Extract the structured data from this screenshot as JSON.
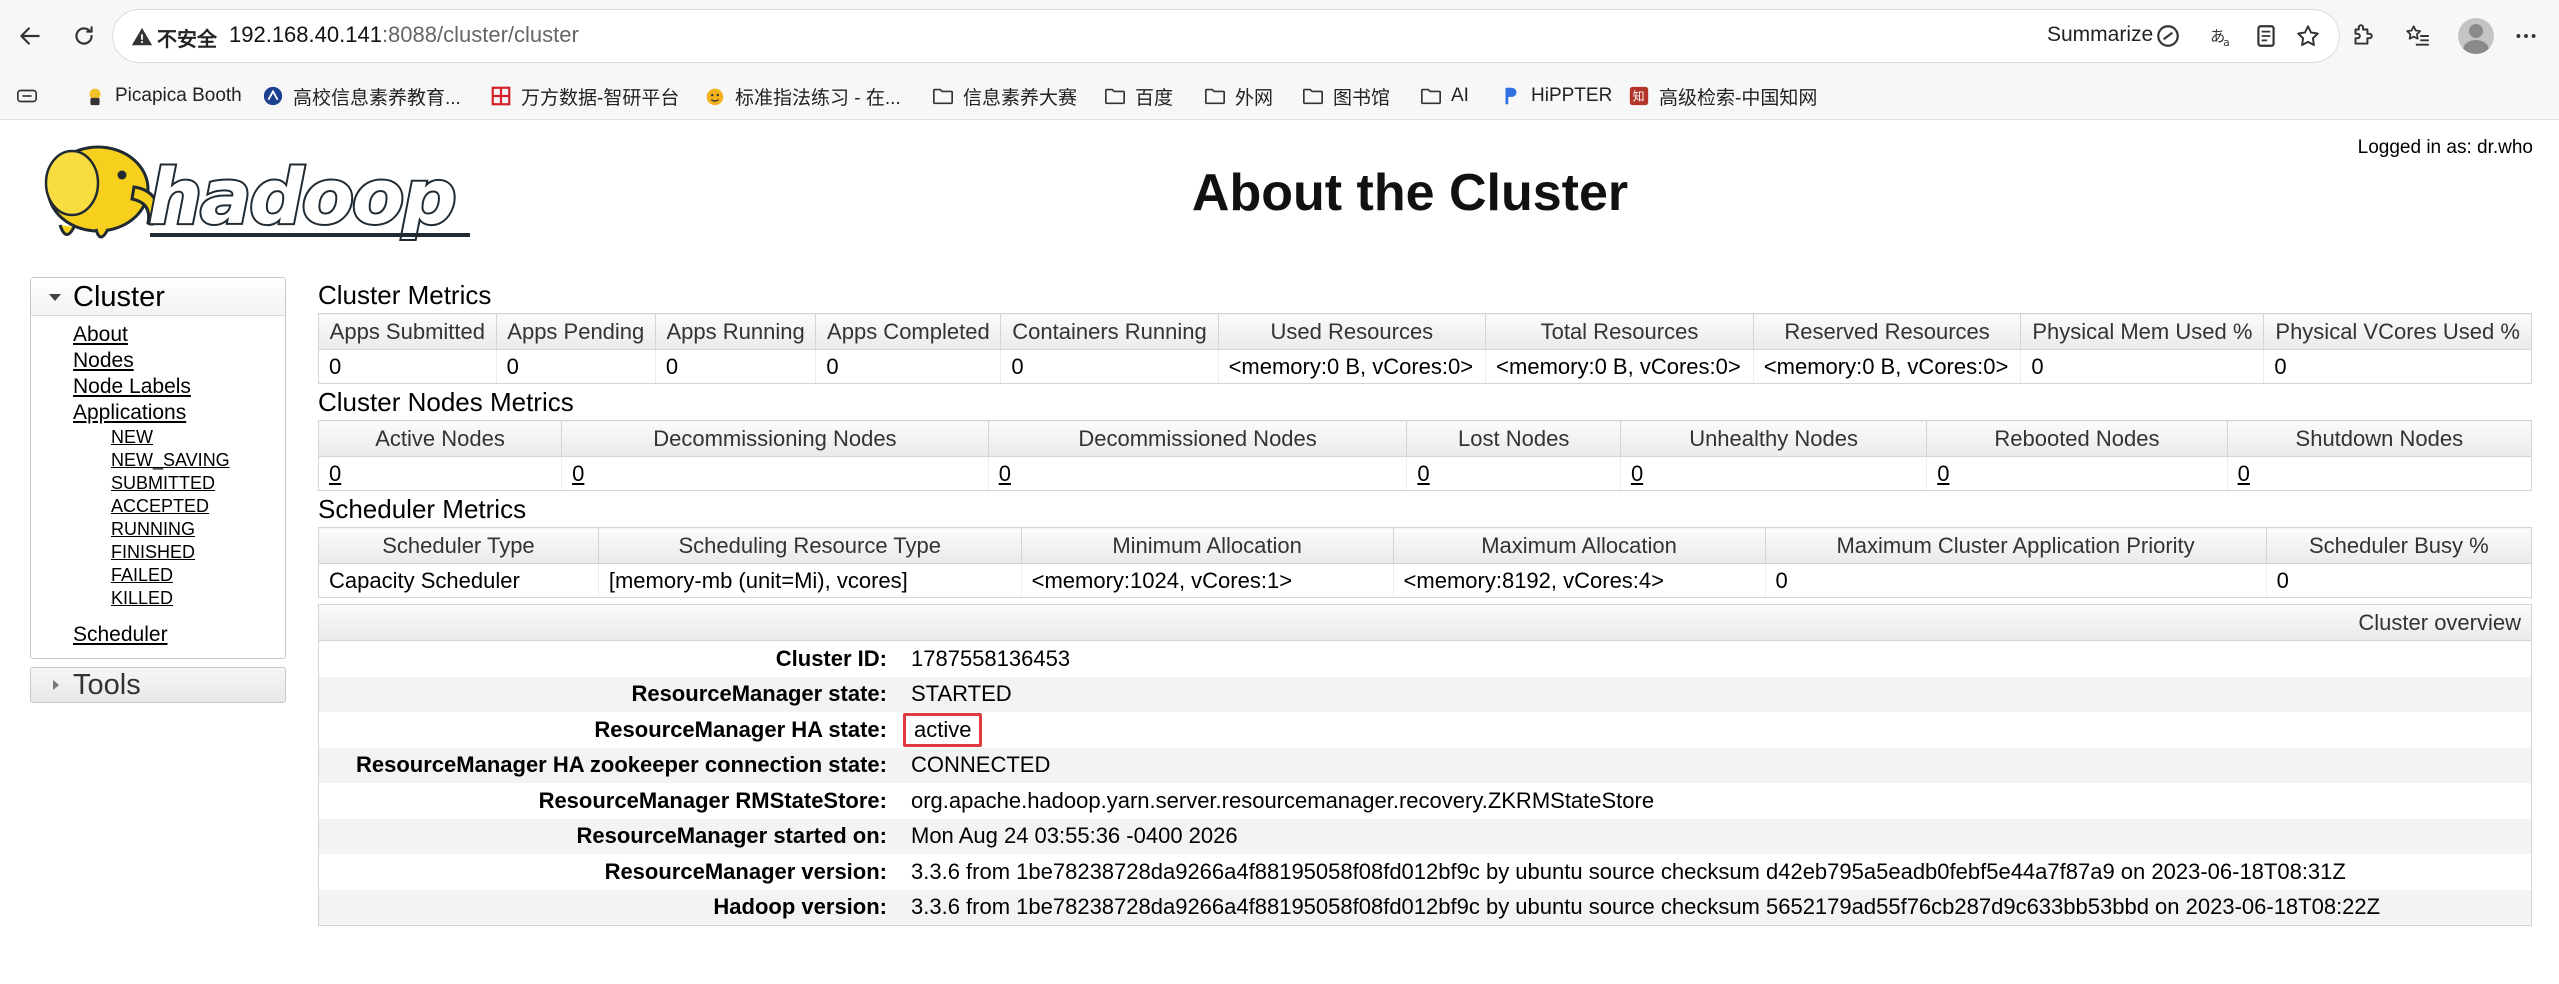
{
  "browser": {
    "insecure_label": "不安全",
    "url_host": "192.168.40.141",
    "url_rest": ":8088/cluster/cluster",
    "summarize_label": "Summarize"
  },
  "bookmarks": [
    {
      "label": "Picapica Booth",
      "icon": "picapica-icon"
    },
    {
      "label": "高校信息素养教育...",
      "icon": "school-icon"
    },
    {
      "label": "万方数据-智研平台",
      "icon": "wanfang-icon"
    },
    {
      "label": "标准指法练习 - 在...",
      "icon": "typing-icon"
    },
    {
      "label": "信息素养大赛",
      "icon": "folder-icon"
    },
    {
      "label": "百度",
      "icon": "folder-icon"
    },
    {
      "label": "外网",
      "icon": "folder-icon"
    },
    {
      "label": "图书馆",
      "icon": "folder-icon"
    },
    {
      "label": "AI",
      "icon": "folder-icon"
    },
    {
      "label": "HiPPTER",
      "icon": "hippter-icon"
    },
    {
      "label": "高级检索-中国知网",
      "icon": "cnki-icon"
    }
  ],
  "header": {
    "logged_in": "Logged in as: dr.who",
    "title": "About the Cluster",
    "logo_text": "hadoop"
  },
  "sidebar": {
    "cluster_label": "Cluster",
    "links": [
      "About",
      "Nodes",
      "Node Labels",
      "Applications"
    ],
    "app_states": [
      "NEW",
      "NEW_SAVING",
      "SUBMITTED",
      "ACCEPTED",
      "RUNNING",
      "FINISHED",
      "FAILED",
      "KILLED"
    ],
    "scheduler_label": "Scheduler",
    "tools_label": "Tools"
  },
  "cluster_metrics": {
    "title": "Cluster Metrics",
    "headers": [
      "Apps Submitted",
      "Apps Pending",
      "Apps Running",
      "Apps Completed",
      "Containers Running",
      "Used Resources",
      "Total Resources",
      "Reserved Resources",
      "Physical Mem Used %",
      "Physical VCores Used %"
    ],
    "values": [
      "0",
      "0",
      "0",
      "0",
      "0",
      "<memory:0 B, vCores:0>",
      "<memory:0 B, vCores:0>",
      "<memory:0 B, vCores:0>",
      "0",
      "0"
    ]
  },
  "node_metrics": {
    "title": "Cluster Nodes Metrics",
    "headers": [
      "Active Nodes",
      "Decommissioning Nodes",
      "Decommissioned Nodes",
      "Lost Nodes",
      "Unhealthy Nodes",
      "Rebooted Nodes",
      "Shutdown Nodes"
    ],
    "values": [
      "0",
      "0",
      "0",
      "0",
      "0",
      "0",
      "0"
    ]
  },
  "scheduler_metrics": {
    "title": "Scheduler Metrics",
    "headers": [
      "Scheduler Type",
      "Scheduling Resource Type",
      "Minimum Allocation",
      "Maximum Allocation",
      "Maximum Cluster Application Priority",
      "Scheduler Busy %"
    ],
    "values": [
      "Capacity Scheduler",
      "[memory-mb (unit=Mi), vcores]",
      "<memory:1024, vCores:1>",
      "<memory:8192, vCores:4>",
      "0",
      "0"
    ]
  },
  "overview": {
    "title": "Cluster overview",
    "rows": [
      {
        "label": "Cluster ID:",
        "value": "1787558136453"
      },
      {
        "label": "ResourceManager state:",
        "value": "STARTED"
      },
      {
        "label": "ResourceManager HA state:",
        "value": "active"
      },
      {
        "label": "ResourceManager HA zookeeper connection state:",
        "value": "CONNECTED"
      },
      {
        "label": "ResourceManager RMStateStore:",
        "value": "org.apache.hadoop.yarn.server.resourcemanager.recovery.ZKRMStateStore"
      },
      {
        "label": "ResourceManager started on:",
        "value": "Mon Aug 24 03:55:36 -0400 2026"
      },
      {
        "label": "ResourceManager version:",
        "value": "3.3.6 from 1be78238728da9266a4f88195058f08fd012bf9c by ubuntu source checksum d42eb795a5eadb0febf5e44a7f87a9 on 2023-06-18T08:31Z"
      },
      {
        "label": "Hadoop version:",
        "value": "3.3.6 from 1be78238728da9266a4f88195058f08fd012bf9c by ubuntu source checksum 5652179ad55f76cb287d9c633bb53bbd on 2023-06-18T08:22Z"
      }
    ]
  },
  "colors": {
    "highlight_border": "#e0393e",
    "logo_yellow": "#f6d01c",
    "logo_text": "#1f2a33"
  }
}
